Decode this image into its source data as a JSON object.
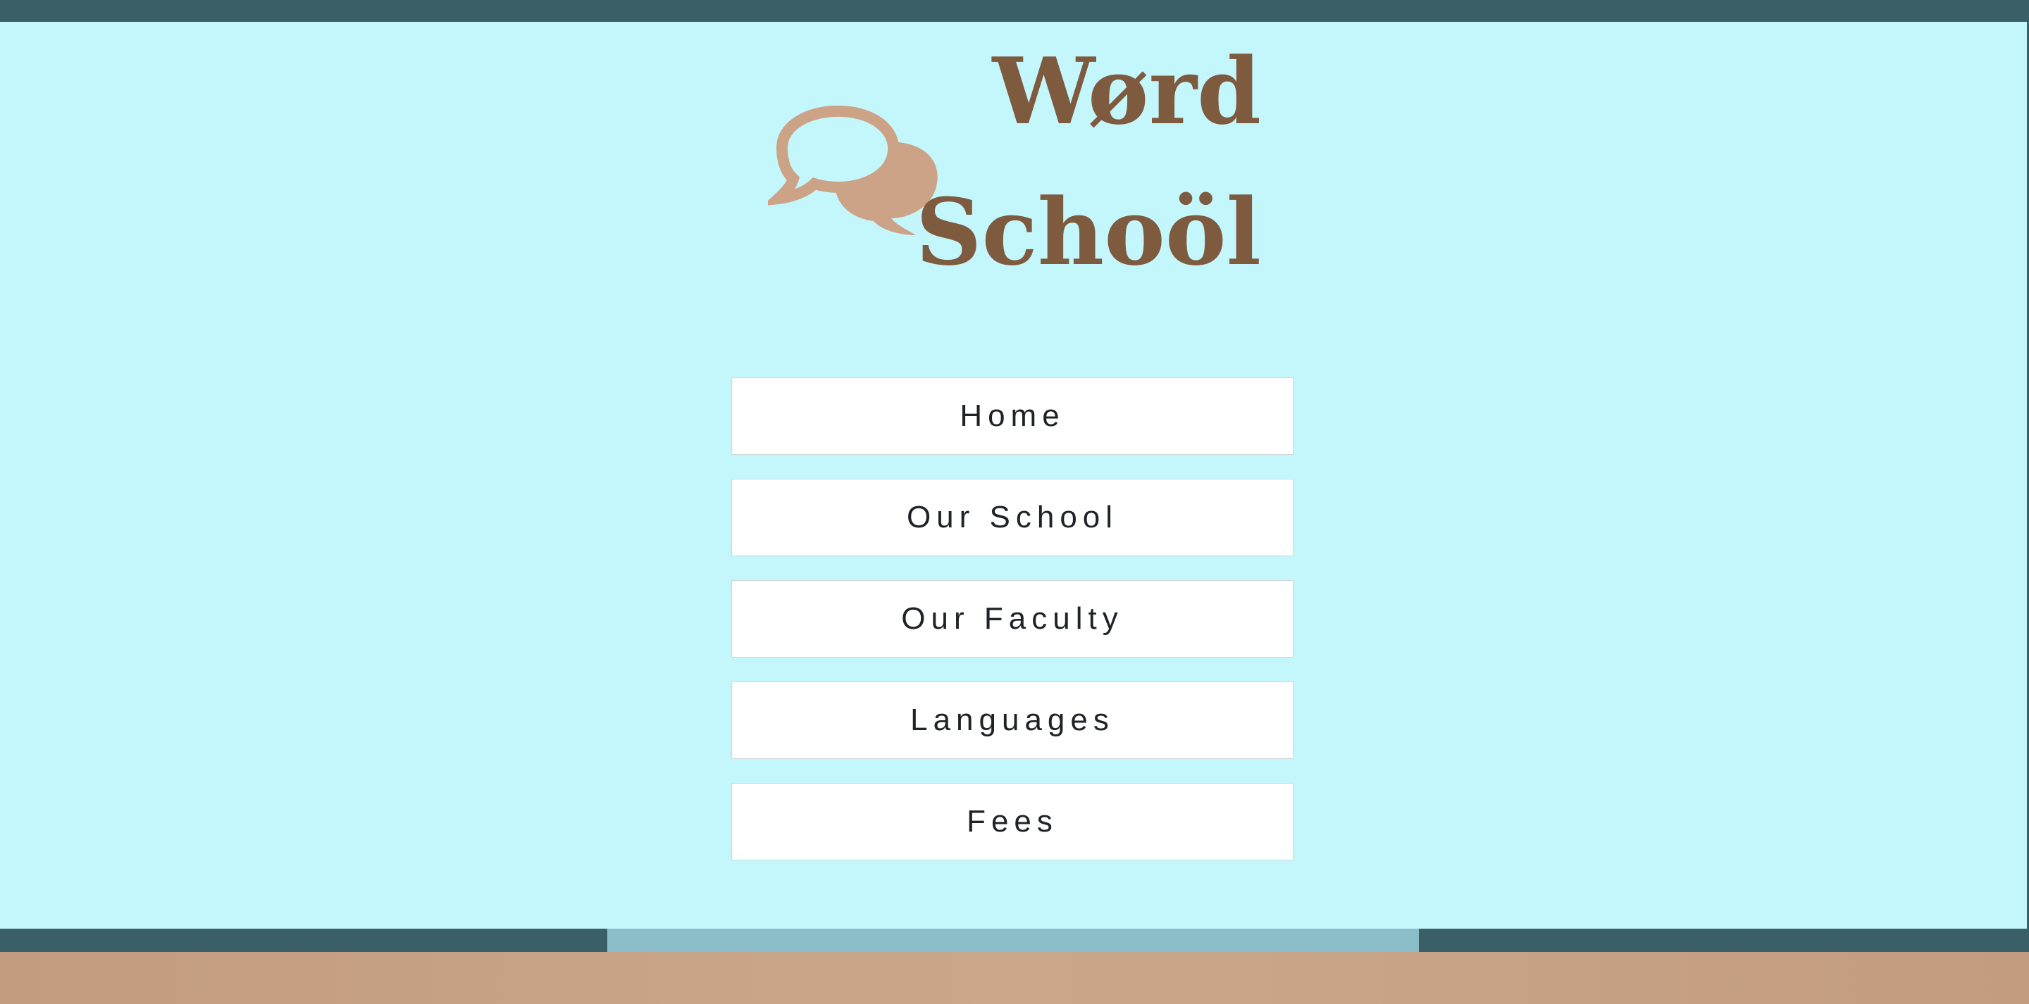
{
  "header": {
    "colors": {
      "bar": "#3a5f66",
      "background": "#c4f7fc"
    }
  },
  "logo": {
    "line1": "Wørd",
    "line2": "Schoöl",
    "icon": "speech-bubbles-icon",
    "text_color": "#7e5a3f",
    "icon_color": "#cda388"
  },
  "nav": {
    "items": [
      {
        "label": "Home"
      },
      {
        "label": "Our School"
      },
      {
        "label": "Our Faculty"
      },
      {
        "label": "Languages"
      },
      {
        "label": "Fees"
      }
    ]
  },
  "footer": {
    "colors": {
      "bar": "#3a5f66",
      "highlight": "#8bbec8",
      "floor": "#c8a488"
    }
  }
}
